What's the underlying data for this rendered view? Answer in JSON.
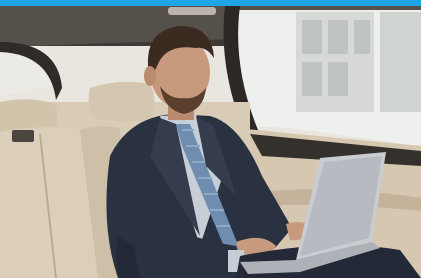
{
  "top_bar": {
    "color": "#1ea7e8"
  },
  "photo": {
    "subject": "businessman-using-laptop-in-car-back-seat",
    "palette": {
      "window_light": "#eef0ee",
      "building": "#cfd3d2",
      "seat_leather": "#d9ccb7",
      "seat_shadow": "#b9aa92",
      "roof": "#3d3a37",
      "suit": "#2a3140",
      "shirt": "#c7ced6",
      "tie": "#6f8db0",
      "skin": "#c79a7d",
      "hair": "#3b2a20",
      "laptop": "#c9ccd0",
      "door_panel": "#d6c7b0"
    }
  }
}
